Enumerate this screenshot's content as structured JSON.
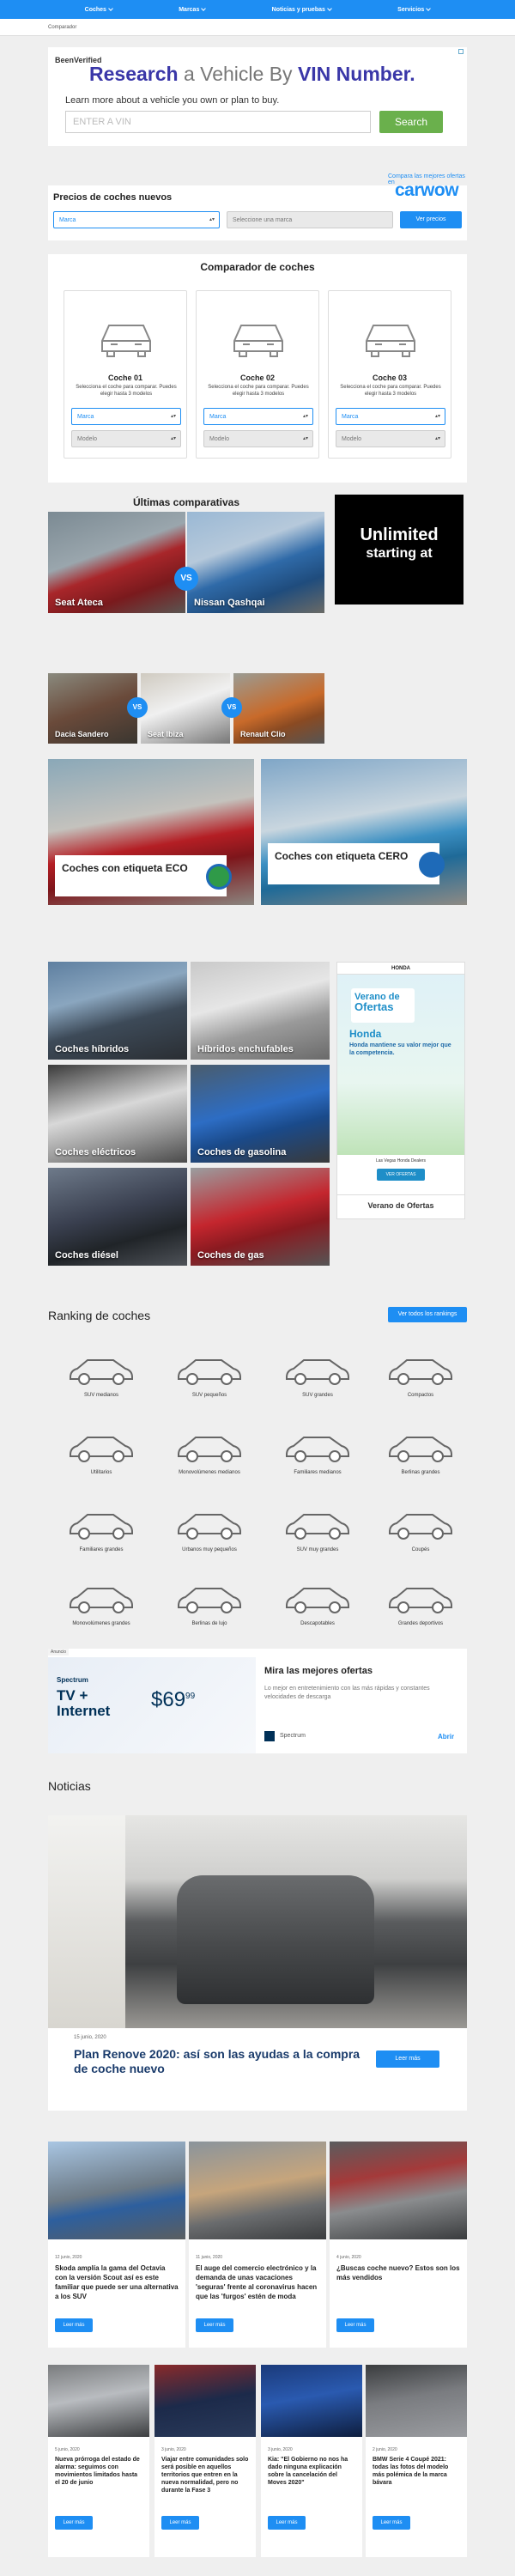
{
  "nav": {
    "items": [
      "Coches",
      "Marcas",
      "Noticias y pruebas",
      "Servicios"
    ]
  },
  "breadcrumb": "Comparador",
  "vin_ad": {
    "logo": "BeenVerified",
    "title_strong1": "Research",
    "title_mid": " a Vehicle By ",
    "title_strong2": "VIN Number.",
    "subtitle": "Learn more about a vehicle you own or plan to buy.",
    "placeholder": "ENTER A VIN",
    "button": "Search"
  },
  "precios": {
    "title": "Precios de coches nuevos",
    "carwow_tag": "Compara las mejores ofertas en",
    "carwow_logo": "carwow",
    "marca": "Marca",
    "marca_placeholder": "Seleccione una marca",
    "button": "Ver precios"
  },
  "comparador": {
    "title": "Comparador de coches",
    "cards": [
      {
        "title": "Coche 01",
        "desc": "Selecciona el coche para comparar. Puedes elegir hasta 3 modelos",
        "marca": "Marca",
        "modelo": "Modelo"
      },
      {
        "title": "Coche 02",
        "desc": "Selecciona el coche para comparar. Puedes elegir hasta 3 modelos",
        "marca": "Marca",
        "modelo": "Modelo"
      },
      {
        "title": "Coche 03",
        "desc": "Selecciona el coche para comparar. Puedes elegir hasta 3 modelos",
        "marca": "Marca",
        "modelo": "Modelo"
      }
    ]
  },
  "ultimas": {
    "title": "Últimas comparativas",
    "vs": "VS",
    "car1": "Seat Ateca",
    "car2": "Nissan Qashqai",
    "small": [
      "Dacia Sandero",
      "Seat Ibiza",
      "Renault Clio"
    ],
    "ad_line1": "Unlimited",
    "ad_line2": "starting at"
  },
  "etiquetas": {
    "eco": "Coches con etiqueta ECO",
    "cero": "Coches con etiqueta CERO"
  },
  "categorias": {
    "items": [
      "Coches híbridos",
      "Híbridos enchufables",
      "Coches eléctricos",
      "Coches de gasolina",
      "Coches diésel",
      "Coches de gas"
    ]
  },
  "honda_ad": {
    "brand": "HONDA",
    "title1": "Verano de",
    "title2": "Ofertas",
    "title3": "Honda",
    "text": "Honda mantiene su valor mejor que la competencia.",
    "dealer": "Las Vegas Honda Dealers",
    "button": "VER OFERTAS",
    "footer": "Verano de Ofertas"
  },
  "ranking": {
    "title": "Ranking de coches",
    "button": "Ver todos los rankings",
    "items": [
      "SUV medianos",
      "SUV pequeños",
      "SUV grandes",
      "Compactos",
      "Utilitarios",
      "Monovolúmenes medianos",
      "Familiares medianos",
      "Berlinas grandes",
      "Familiares grandes",
      "Urbanos muy pequeños",
      "SUV muy grandes",
      "Coupés",
      "Monovolúmenes grandes",
      "Berlinas de lujo",
      "Descapotables",
      "Grandes deportivos"
    ]
  },
  "spectrum_ad": {
    "tag": "Anuncio",
    "brand": "Spectrum",
    "product1": "TV +",
    "product2": "Internet",
    "price": "$69",
    "price_cents": "99",
    "headline": "Mira las mejores ofertas",
    "body": "Lo mejor en entretenimiento con las más rápidas y constantes velocidades de descarga",
    "advertiser": "Spectrum",
    "cta": "Abrir"
  },
  "noticias": {
    "title": "Noticias",
    "main": {
      "date": "15 junio, 2020",
      "title": "Plan Renove 2020: así son las ayudas a la compra de coche nuevo",
      "button": "Leer más"
    },
    "row1": [
      {
        "date": "12 junio, 2020",
        "title": "Skoda amplía la gama del Octavia con la versión Scout así es este familiar que puede ser una alternativa a los SUV",
        "button": "Leer más"
      },
      {
        "date": "11 junio, 2020",
        "title": "El auge del comercio electrónico y la demanda de unas vacaciones 'seguras' frente al coronavirus hacen que las 'furgos' estén de moda",
        "button": "Leer más"
      },
      {
        "date": "4 junio, 2020",
        "title": "¿Buscas coche nuevo? Estos son los más vendidos",
        "button": "Leer más"
      }
    ],
    "row2": [
      {
        "date": "5 junio, 2020",
        "title": "Nueva prórroga del estado de alarma: seguimos con movimientos limitados hasta el 20 de junio",
        "button": "Leer más"
      },
      {
        "date": "3 junio, 2020",
        "title": "Viajar entre comunidades solo será posible en aquellos territorios que entren en la nueva normalidad, pero no durante la Fase 3",
        "button": "Leer más"
      },
      {
        "date": "3 junio, 2020",
        "title": "Kia: \"El Gobierno no nos ha dado ninguna explicación sobre la cancelación del Moves 2020\"",
        "button": "Leer más"
      },
      {
        "date": "2 junio, 2020",
        "title": "BMW Serie 4 Coupé 2021: todas las fotos del modelo más polémica de la marca bávara",
        "button": "Leer más"
      }
    ]
  }
}
